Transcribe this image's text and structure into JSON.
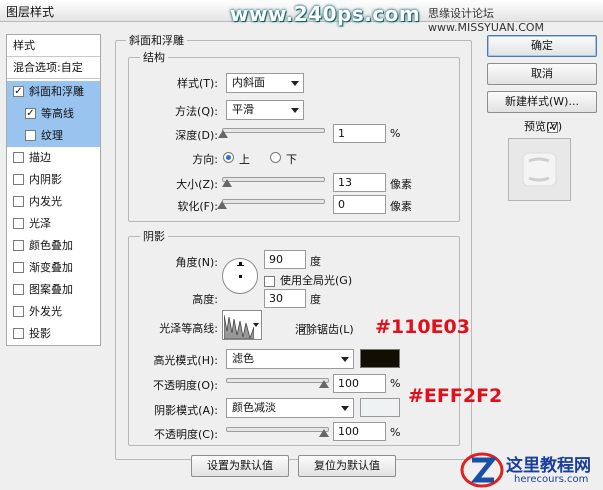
{
  "window": {
    "title": "图层样式",
    "watermark_site": "www.240ps.com",
    "watermark_right": "思缘设计论坛 www.MISSYUAN.COM"
  },
  "sidebar": {
    "header": "样式",
    "blend_options": "混合选项:自定",
    "items": [
      {
        "label": "斜面和浮雕",
        "checked": true,
        "selected": true
      },
      {
        "label": "等高线",
        "checked": true,
        "selected": true
      },
      {
        "label": "纹理",
        "checked": false,
        "selected": true
      },
      {
        "label": "描边",
        "checked": false
      },
      {
        "label": "内阴影",
        "checked": false
      },
      {
        "label": "内发光",
        "checked": false
      },
      {
        "label": "光泽",
        "checked": false
      },
      {
        "label": "颜色叠加",
        "checked": false
      },
      {
        "label": "渐变叠加",
        "checked": false
      },
      {
        "label": "图案叠加",
        "checked": false
      },
      {
        "label": "外发光",
        "checked": false
      },
      {
        "label": "投影",
        "checked": false
      }
    ]
  },
  "bevel": {
    "group_title": "斜面和浮雕",
    "structure_title": "结构",
    "style_label": "样式(T):",
    "style_value": "内斜面",
    "technique_label": "方法(Q):",
    "technique_value": "平滑",
    "depth_label": "深度(D):",
    "depth_value": "1",
    "depth_unit": "%",
    "depth_level": 0.01,
    "direction_label": "方向:",
    "direction_up": "上",
    "direction_down": "下",
    "size_label": "大小(Z):",
    "size_value": "13",
    "size_unit": "像素",
    "size_level": 0.05,
    "soften_label": "软化(F):",
    "soften_value": "0",
    "soften_unit": "像素",
    "soften_level": 0
  },
  "shading": {
    "title": "阴影",
    "angle_label": "角度(N):",
    "angle_value": "90",
    "angle_unit": "度",
    "global_light_label": "使用全局光(G)",
    "global_light_checked": false,
    "altitude_label": "高度:",
    "altitude_value": "30",
    "altitude_unit": "度",
    "gloss_contour_label": "光泽等高线:",
    "antialias_label": "消除锯齿(L)",
    "antialias_checked": true,
    "highlight_mode_label": "高光模式(H):",
    "highlight_mode_value": "滤色",
    "highlight_color": "#110E03",
    "highlight_opacity_label": "不透明度(O):",
    "highlight_opacity_value": "100",
    "highlight_opacity_unit": "%",
    "shadow_mode_label": "阴影模式(A):",
    "shadow_mode_value": "颜色减淡",
    "shadow_color": "#EFF2F2",
    "shadow_opacity_label": "不透明度(C):",
    "shadow_opacity_value": "100",
    "shadow_opacity_unit": "%"
  },
  "footer": {
    "make_default": "设置为默认值",
    "reset_default": "复位为默认值"
  },
  "buttons": {
    "ok": "确定",
    "cancel": "取消",
    "new_style": "新建样式(W)...",
    "preview_label": "预览(V)",
    "preview_checked": true
  },
  "annotations": {
    "highlight_hex": "#110E03",
    "shadow_hex": "#EFF2F2"
  },
  "logo": {
    "text": "这里教程网",
    "url_text": "herecours.com"
  }
}
